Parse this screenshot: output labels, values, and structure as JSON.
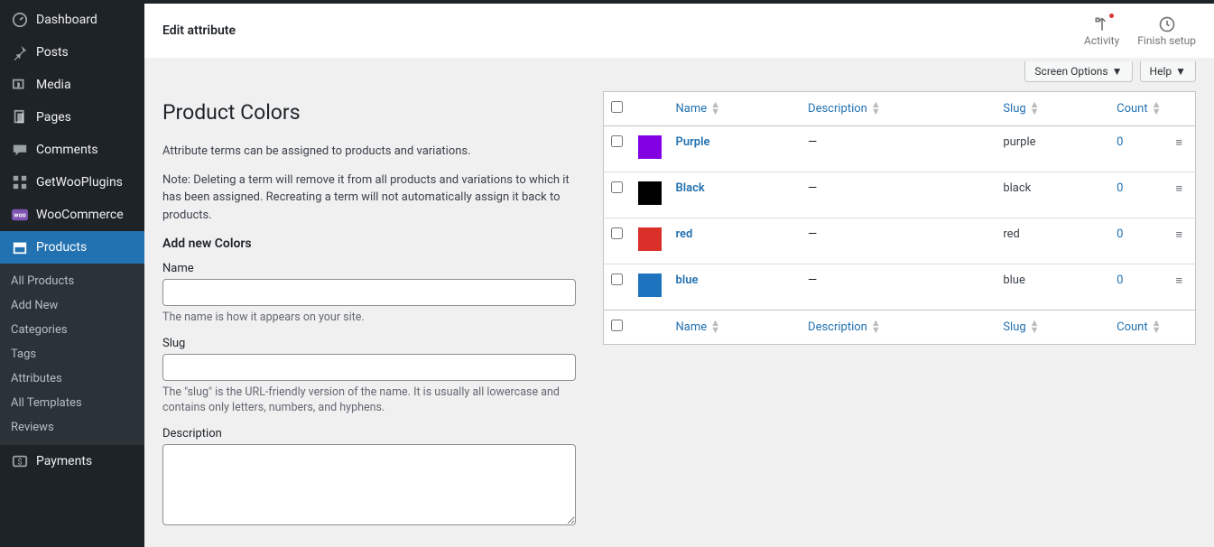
{
  "sidebar": {
    "items": [
      {
        "label": "Dashboard",
        "icon": "dashboard"
      },
      {
        "label": "Posts",
        "icon": "pin"
      },
      {
        "label": "Media",
        "icon": "media"
      },
      {
        "label": "Pages",
        "icon": "pages"
      },
      {
        "label": "Comments",
        "icon": "comment"
      },
      {
        "label": "GetWooPlugins",
        "icon": "grid"
      },
      {
        "label": "WooCommerce",
        "icon": "woo"
      },
      {
        "label": "Products",
        "icon": "archive",
        "active": true
      },
      {
        "label": "Payments",
        "icon": "dollar"
      }
    ],
    "submenu": [
      {
        "label": "All Products"
      },
      {
        "label": "Add New"
      },
      {
        "label": "Categories"
      },
      {
        "label": "Tags"
      },
      {
        "label": "Attributes"
      },
      {
        "label": "All Templates"
      },
      {
        "label": "Reviews"
      }
    ]
  },
  "topbar": {
    "title": "Edit attribute",
    "activity": "Activity",
    "finish": "Finish setup"
  },
  "tabs": {
    "screen_options": "Screen Options",
    "help": "Help"
  },
  "page": {
    "heading": "Product Colors",
    "intro": "Attribute terms can be assigned to products and variations.",
    "note": "Note: Deleting a term will remove it from all products and variations to which it has been assigned. Recreating a term will not automatically assign it back to products.",
    "add_heading": "Add new Colors",
    "name_label": "Name",
    "name_help": "The name is how it appears on your site.",
    "slug_label": "Slug",
    "slug_help": "The \"slug\" is the URL-friendly version of the name. It is usually all lowercase and contains only letters, numbers, and hyphens.",
    "desc_label": "Description"
  },
  "table": {
    "cols": {
      "name": "Name",
      "desc": "Description",
      "slug": "Slug",
      "count": "Count"
    },
    "rows": [
      {
        "name": "Purple",
        "desc": "—",
        "slug": "purple",
        "count": "0",
        "color": "#8200e2"
      },
      {
        "name": "Black",
        "desc": "—",
        "slug": "black",
        "count": "0",
        "color": "#000000"
      },
      {
        "name": "red",
        "desc": "—",
        "slug": "red",
        "count": "0",
        "color": "#d9302a"
      },
      {
        "name": "blue",
        "desc": "—",
        "slug": "blue",
        "count": "0",
        "color": "#1e73be"
      }
    ]
  }
}
